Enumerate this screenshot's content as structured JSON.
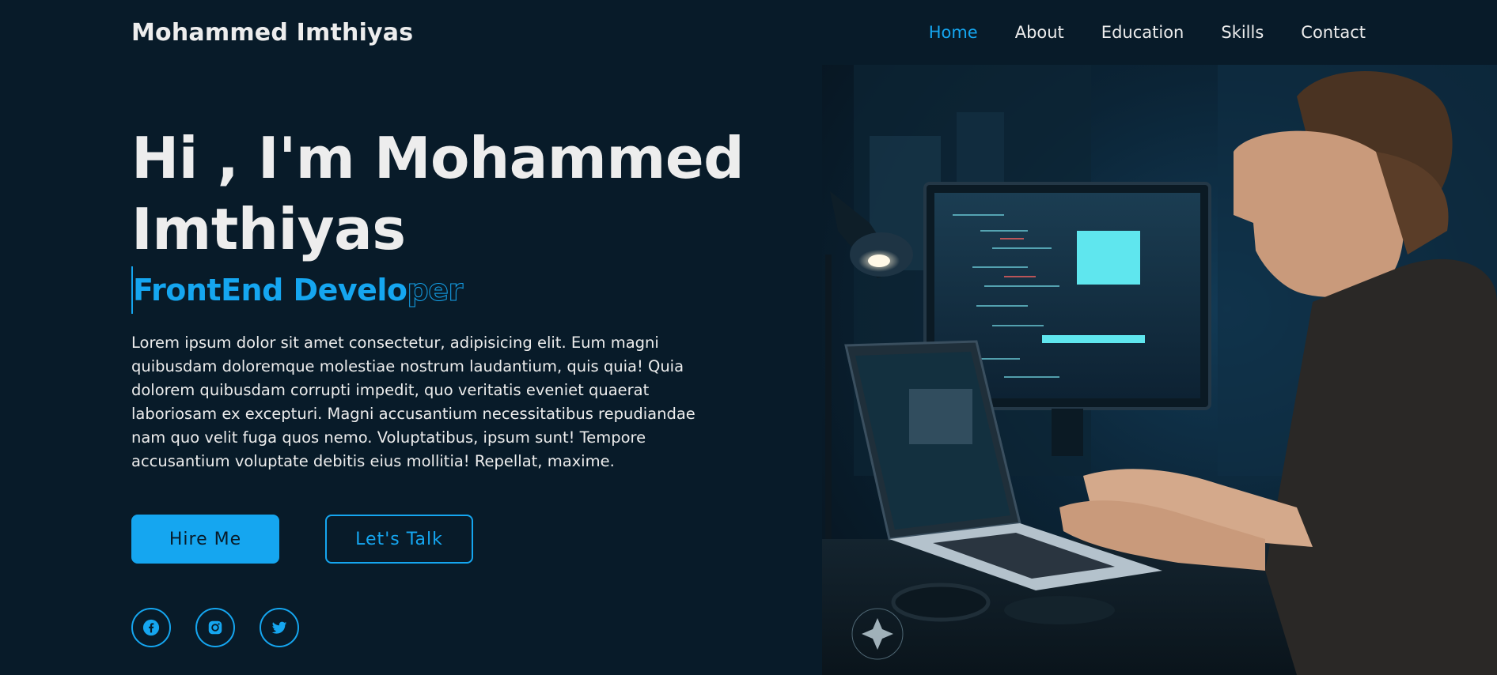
{
  "header": {
    "logo": "Mohammed Imthiyas",
    "nav": [
      {
        "label": "Home",
        "active": true
      },
      {
        "label": "About"
      },
      {
        "label": "Education"
      },
      {
        "label": "Skills"
      },
      {
        "label": "Contact"
      }
    ]
  },
  "hero": {
    "title_line1": "Hi , I'm Mohammed",
    "title_line2": "Imthiyas",
    "role_filled": "FrontEnd Develo",
    "role_outline": "per",
    "description": "Lorem ipsum dolor sit amet consectetur, adipisicing elit. Eum magni quibusdam doloremque molestiae nostrum laudantium, quis quia! Quia dolorem quibusdam corrupti impedit, quo veritatis eveniet quaerat laboriosam ex excepturi. Magni accusantium necessitatibus repudiandae nam quo velit fuga quos nemo. Voluptatibus, ipsum sunt! Tempore accusantium voluptate debitis eius mollitia! Repellat, maxime.",
    "hire_label": "Hire Me",
    "talk_label": "Let's Talk"
  },
  "social": [
    {
      "icon": "facebook-icon"
    },
    {
      "icon": "instagram-icon"
    },
    {
      "icon": "twitter-icon"
    }
  ],
  "colors": {
    "background": "#081b29",
    "accent": "#15a6f0",
    "text": "#ededed"
  }
}
